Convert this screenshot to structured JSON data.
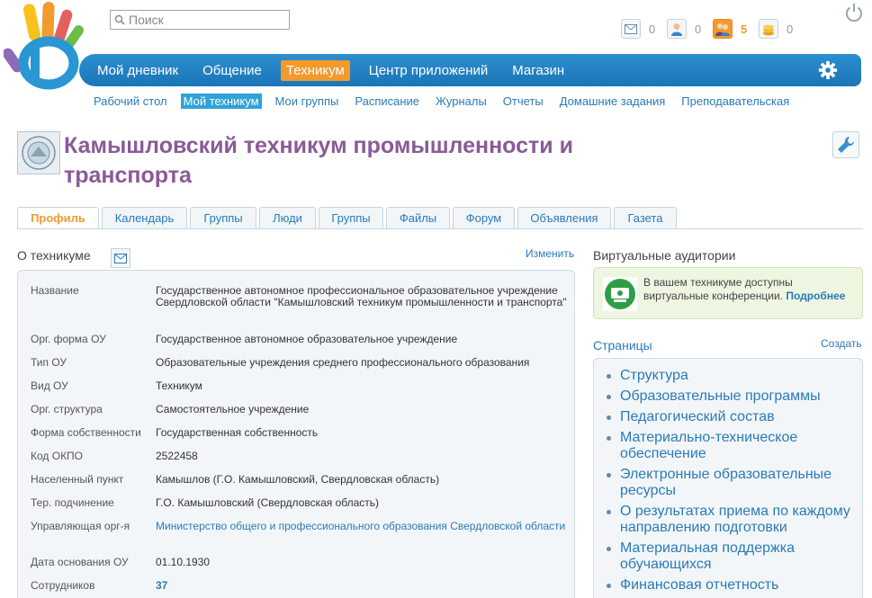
{
  "search": {
    "placeholder": "Поиск"
  },
  "notifications": [
    {
      "name": "messages",
      "count": "0",
      "icon": "envelope-icon"
    },
    {
      "name": "friends",
      "count": "0",
      "icon": "person-icon"
    },
    {
      "name": "invitations",
      "count": "5",
      "icon": "people-icon",
      "active": true
    },
    {
      "name": "coins",
      "count": "0",
      "icon": "coins-icon"
    }
  ],
  "main_nav": [
    {
      "label": "Мой дневник"
    },
    {
      "label": "Общение"
    },
    {
      "label": "Техникум",
      "active": true
    },
    {
      "label": "Центр приложений"
    },
    {
      "label": "Магазин"
    }
  ],
  "sub_nav": [
    {
      "label": "Рабочий стол"
    },
    {
      "label": "Мой техникум",
      "active": true
    },
    {
      "label": "Мои группы"
    },
    {
      "label": "Расписание"
    },
    {
      "label": "Журналы"
    },
    {
      "label": "Отчеты"
    },
    {
      "label": "Домашние задания"
    },
    {
      "label": "Преподавательская"
    }
  ],
  "header": {
    "title": "Камышловский техникум промышленности и транспорта"
  },
  "tabs": [
    {
      "label": "Профиль",
      "active": true
    },
    {
      "label": "Календарь"
    },
    {
      "label": "Группы"
    },
    {
      "label": "Люди"
    },
    {
      "label": "Группы"
    },
    {
      "label": "Файлы"
    },
    {
      "label": "Форум"
    },
    {
      "label": "Объявления"
    },
    {
      "label": "Газета"
    }
  ],
  "about": {
    "title": "О техникуме",
    "edit_label": "Изменить",
    "rows": [
      {
        "label": "Название",
        "value": "Государственное автономное профессиональное образовательное учреждение Свердловской области \"Камышловский техникум промышленности и транспорта\""
      },
      {
        "label": "Орг. форма ОУ",
        "value": "Государственное автономное образовательное учреждение"
      },
      {
        "label": "Тип ОУ",
        "value": "Образовательные учреждения среднего профессионального образования"
      },
      {
        "label": "Вид ОУ",
        "value": "Техникум"
      },
      {
        "label": "Орг. структура",
        "value": "Самостоятельное учреждение"
      },
      {
        "label": "Форма собственности",
        "value": "Государственная собственность"
      },
      {
        "label": "Код ОКПО",
        "value": "2522458"
      },
      {
        "label": "Населенный пункт",
        "value": "Камышлов (Г.О. Камышловский, Свердловская область)"
      },
      {
        "label": "Тер. подчинение",
        "value": "Г.О. Камышловский (Свердловская область)"
      },
      {
        "label": "Управляющая орг-я",
        "value": "Министерство общего и профессионального образования Свердловской области",
        "link": true
      },
      {
        "label": "Дата основания ОУ",
        "value": "01.10.1930"
      },
      {
        "label": "Сотрудников",
        "value": "37",
        "link": true
      }
    ]
  },
  "virtual": {
    "title": "Виртуальные аудитории",
    "text": "В вашем техникуме доступны виртуальные конференции.",
    "more": "Подробнее"
  },
  "pages": {
    "title": "Страницы",
    "create_label": "Создать",
    "items": [
      "Структура",
      "Образовательные программы",
      "Педагогический состав",
      "Материально-техническое обеспечение",
      "Электронные образовательные ресурсы",
      "О результатах приема по каждому направлению подготовки",
      "Материальная поддержка обучающихся",
      "Финансовая отчетность"
    ]
  },
  "colors": {
    "nav_blue": "#1f80c2",
    "accent_orange": "#f29a2e",
    "title_purple": "#8a5a97",
    "link_blue": "#2a7bb7"
  }
}
